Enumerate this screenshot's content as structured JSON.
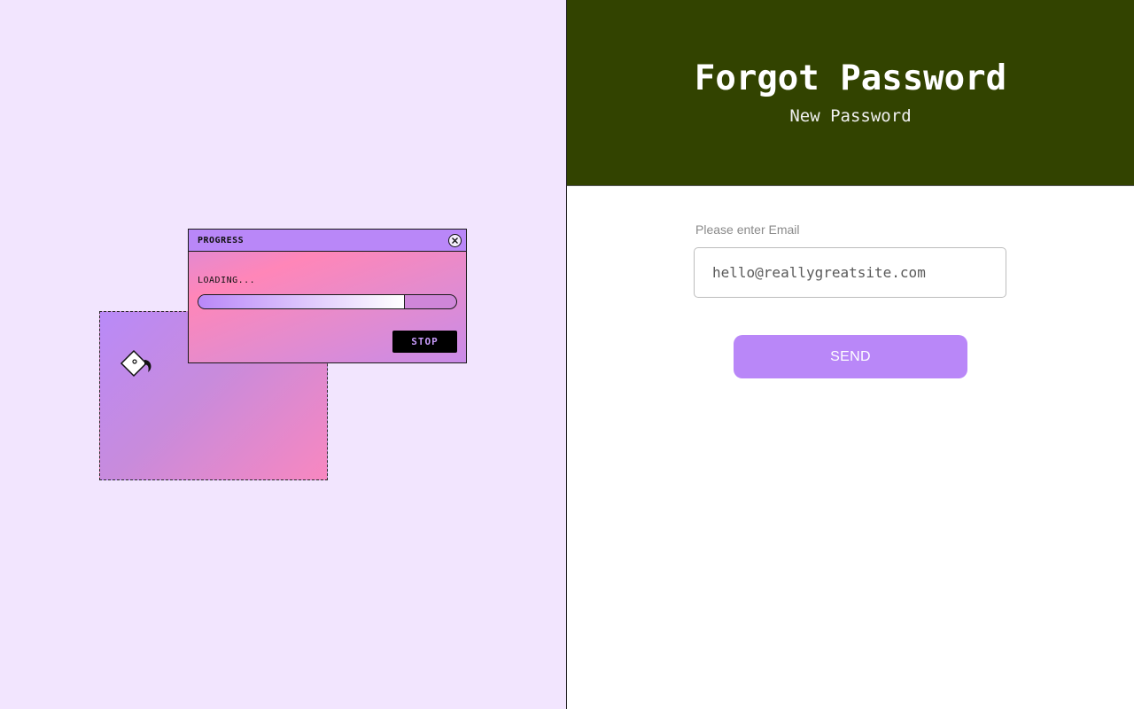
{
  "illustration": {
    "progress_window": {
      "title": "PROGRESS",
      "loading_text": "LOADING...",
      "progress_fraction": 0.8,
      "stop_label": "STOP"
    }
  },
  "header": {
    "title": "Forgot Password",
    "subtitle": "New Password"
  },
  "form": {
    "email_label": "Please enter Email",
    "email_placeholder": "hello@reallygreatsite.com",
    "send_label": "SEND"
  },
  "colors": {
    "header_bg": "#324300",
    "accent": "#b987f8",
    "left_bg": "#f2e5fe"
  }
}
